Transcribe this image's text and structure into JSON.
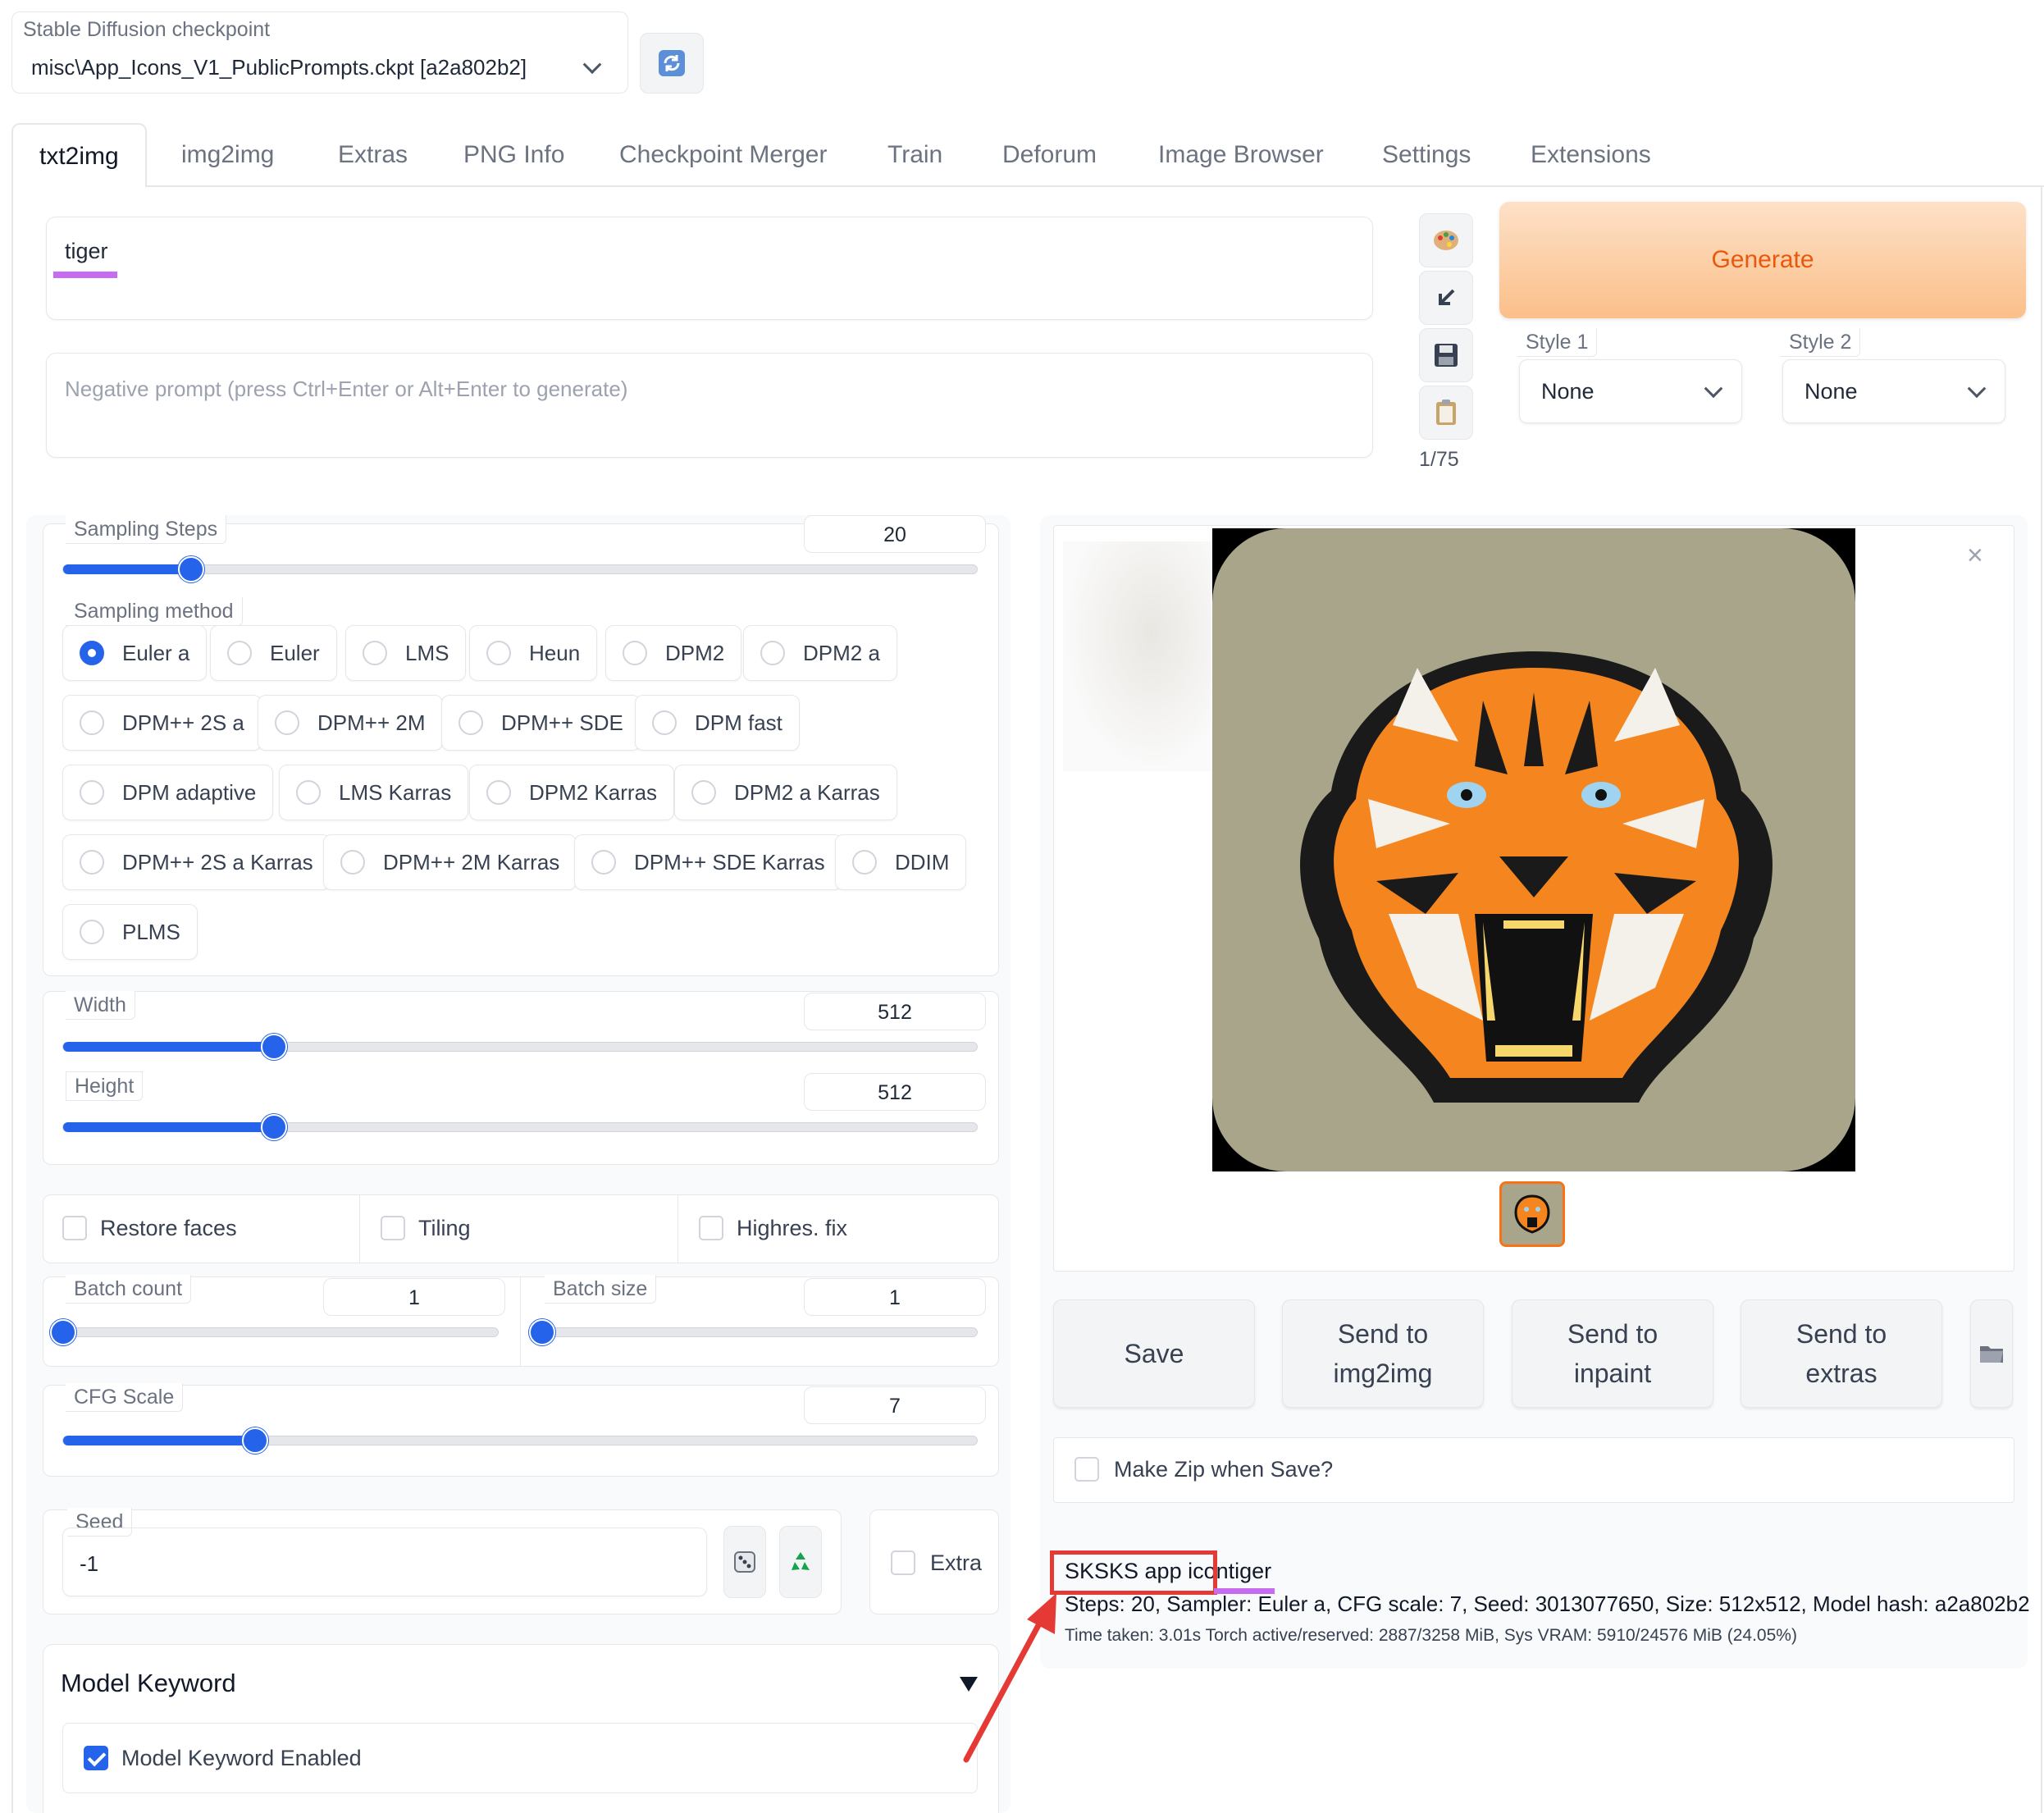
{
  "checkpoint": {
    "label": "Stable Diffusion checkpoint",
    "value": "misc\\App_Icons_V1_PublicPrompts.ckpt [a2a802b2]"
  },
  "tabs": [
    "txt2img",
    "img2img",
    "Extras",
    "PNG Info",
    "Checkpoint Merger",
    "Train",
    "Deforum",
    "Image Browser",
    "Settings",
    "Extensions"
  ],
  "prompt": {
    "value": "tiger",
    "negative_placeholder": "Negative prompt (press Ctrl+Enter or Alt+Enter to generate)",
    "token_count": "1/75"
  },
  "generate_label": "Generate",
  "styles": [
    {
      "label": "Style 1",
      "value": "None"
    },
    {
      "label": "Style 2",
      "value": "None"
    }
  ],
  "sampling_steps": {
    "label": "Sampling Steps",
    "value": "20"
  },
  "sampling_method": {
    "label": "Sampling method",
    "selected": "Euler a",
    "options": [
      "Euler a",
      "Euler",
      "LMS",
      "Heun",
      "DPM2",
      "DPM2 a",
      "DPM++ 2S a",
      "DPM++ 2M",
      "DPM++ SDE",
      "DPM fast",
      "DPM adaptive",
      "LMS Karras",
      "DPM2 Karras",
      "DPM2 a Karras",
      "DPM++ 2S a Karras",
      "DPM++ 2M Karras",
      "DPM++ SDE Karras",
      "DDIM",
      "PLMS"
    ]
  },
  "width": {
    "label": "Width",
    "value": "512"
  },
  "height": {
    "label": "Height",
    "value": "512"
  },
  "checkboxes": {
    "restore_faces": "Restore faces",
    "tiling": "Tiling",
    "highres": "Highres. fix"
  },
  "batch_count": {
    "label": "Batch count",
    "value": "1"
  },
  "batch_size": {
    "label": "Batch size",
    "value": "1"
  },
  "cfg_scale": {
    "label": "CFG Scale",
    "value": "7"
  },
  "seed": {
    "label": "Seed",
    "value": "-1",
    "extra_label": "Extra"
  },
  "model_keyword": {
    "title": "Model Keyword",
    "enabled_label": "Model Keyword Enabled"
  },
  "actions": {
    "save": "Save",
    "send_img2img": "Send to\nimg2img",
    "send_inpaint": "Send to\ninpaint",
    "send_extras": "Send to\nextras"
  },
  "make_zip_label": "Make Zip when Save?",
  "output": {
    "prompt_prefix": "SKSKS app icon",
    "prompt_suffix": "tiger",
    "params": "Steps: 20, Sampler: Euler a, CFG scale: 7, Seed: 3013077650, Size: 512x512, Model hash: a2a802b2",
    "time_info": "Time taken: 3.01s  Torch active/reserved: 2887/3258 MiB, Sys VRAM: 5910/24576 MiB (24.05%)"
  },
  "slider_levels": {
    "sampling_steps": 0.14,
    "width": 0.23,
    "height": 0.23,
    "batch_count": 0.0,
    "batch_size": 0.0,
    "cfg_scale": 0.21
  },
  "colors": {
    "accent": "#2563eb",
    "generate_bg": "#fbbf8a",
    "generate_text": "#ea580c",
    "annotation_red": "#e53935",
    "underline_purple": "#c56cf0"
  }
}
